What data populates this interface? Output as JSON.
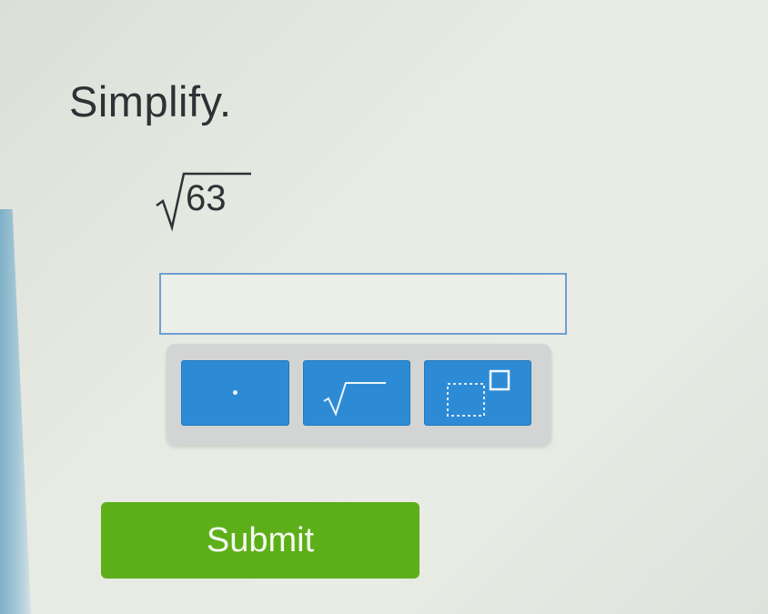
{
  "problem": {
    "prompt": "Simplify.",
    "radicand": "63"
  },
  "answer": {
    "value": "",
    "placeholder": ""
  },
  "keypad": {
    "keys": [
      {
        "icon": "dot-icon"
      },
      {
        "icon": "square-root-icon"
      },
      {
        "icon": "exponent-icon"
      }
    ]
  },
  "submit": {
    "label": "Submit"
  },
  "colors": {
    "accent_blue": "#2d8bd6",
    "submit_green": "#5daf1a",
    "input_border": "#6e9fd0"
  }
}
